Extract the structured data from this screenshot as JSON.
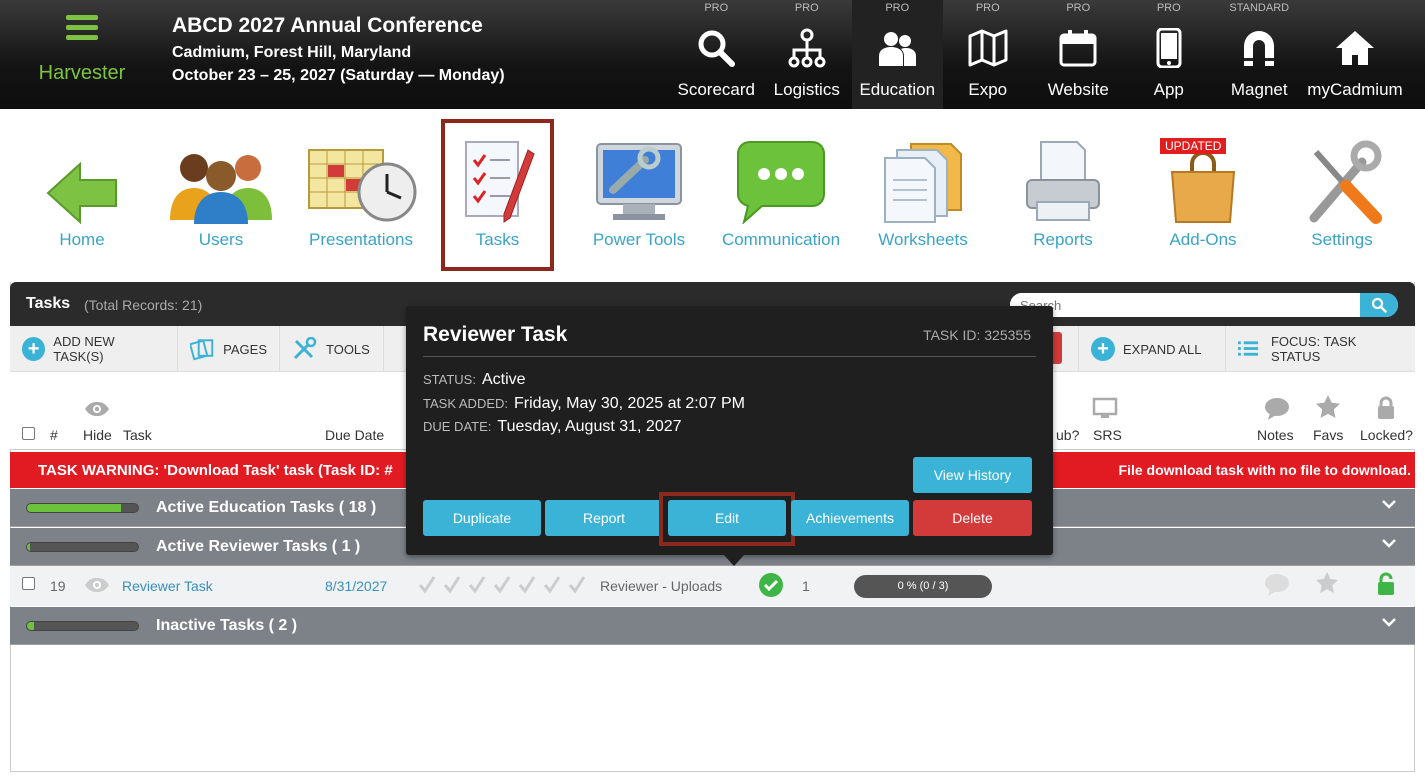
{
  "brand": {
    "name": "Harvester"
  },
  "conference": {
    "title": "ABCD 2027 Annual Conference",
    "location": "Cadmium, Forest Hill, Maryland",
    "dates": "October 23 – 25, 2027 (Saturday — Monday)"
  },
  "modules": [
    {
      "tier": "PRO",
      "label": "Scorecard",
      "icon": "search-icon"
    },
    {
      "tier": "PRO",
      "label": "Logistics",
      "icon": "hierarchy-icon"
    },
    {
      "tier": "PRO",
      "label": "Education",
      "icon": "people-icon"
    },
    {
      "tier": "PRO",
      "label": "Expo",
      "icon": "map-icon"
    },
    {
      "tier": "PRO",
      "label": "Website",
      "icon": "calendar-icon"
    },
    {
      "tier": "PRO",
      "label": "App",
      "icon": "phone-icon"
    },
    {
      "tier": "STANDARD",
      "label": "Magnet",
      "icon": "magnet-icon"
    },
    {
      "tier": "",
      "label": "myCadmium",
      "icon": "home-icon"
    }
  ],
  "apps": [
    {
      "label": "Home"
    },
    {
      "label": "Users"
    },
    {
      "label": "Presentations"
    },
    {
      "label": "Tasks"
    },
    {
      "label": "Power Tools"
    },
    {
      "label": "Communication"
    },
    {
      "label": "Worksheets"
    },
    {
      "label": "Reports"
    },
    {
      "label": "Add-Ons",
      "badge": "UPDATED"
    },
    {
      "label": "Settings"
    }
  ],
  "panel": {
    "title": "Tasks",
    "count": "(Total Records: 21)",
    "search_placeholder": "Search"
  },
  "toolbar": {
    "add": "ADD NEW TASK(S)",
    "pages": "PAGES",
    "tools": "TOOLS",
    "expand": "EXPAND ALL",
    "focus": "FOCUS: TASK STATUS"
  },
  "columns": {
    "num": "#",
    "hide": "Hide",
    "task": "Task",
    "due": "Due Date",
    "pub": "ub?",
    "srs": "SRS",
    "notes": "Notes",
    "favs": "Favs",
    "locked": "Locked?"
  },
  "warning": {
    "left": "TASK WARNING: 'Download Task' task (Task ID: #",
    "right": "File download task with no file to download."
  },
  "groups": [
    {
      "label": "Active Education Tasks   ( 18 )",
      "progress": 0.85
    },
    {
      "label": "Active Reviewer Tasks   ( 1 )",
      "progress": 0.03
    },
    {
      "label": "Inactive Tasks   ( 2 )",
      "progress": 0.06
    }
  ],
  "row": {
    "num": "19",
    "task": "Reviewer Task",
    "due": "8/31/2027",
    "type": "Reviewer - Uploads",
    "count": "1",
    "progress": "0 % (0 / 3)"
  },
  "popup": {
    "title": "Reviewer Task",
    "task_id": "TASK ID: 325355",
    "status_k": "STATUS:",
    "status_v": "Active",
    "added_k": "TASK ADDED:",
    "added_v": "Friday, May 30, 2025 at 2:07 PM",
    "due_k": "DUE DATE:",
    "due_v": "Tuesday, August 31, 2027",
    "history": "View History",
    "duplicate": "Duplicate",
    "report": "Report",
    "edit": "Edit",
    "achievements": "Achievements",
    "delete": "Delete"
  },
  "colors": {
    "accent": "#3bb3d6",
    "brand": "#7dc242",
    "warning": "#e21b23",
    "highlight": "#8b2a1c"
  }
}
